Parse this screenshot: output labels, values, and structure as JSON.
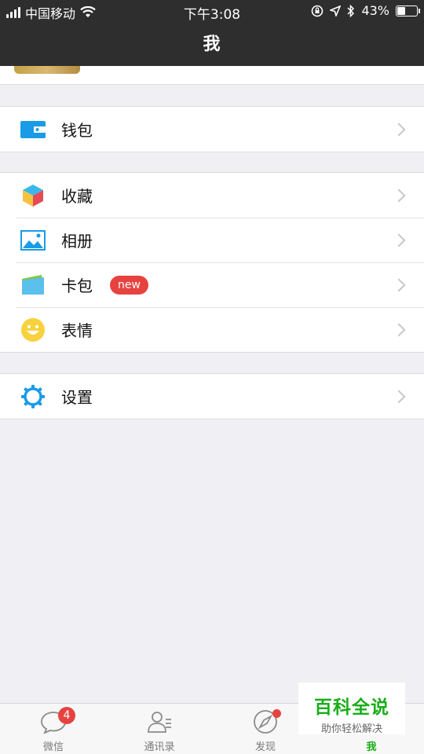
{
  "status_bar": {
    "carrier": "中国移动",
    "time": "下午3:08",
    "battery": "43%",
    "battery_level": 0.43,
    "icons": [
      "signal-icon",
      "wifi-icon",
      "lock-rotation-icon",
      "location-icon",
      "bluetooth-icon",
      "battery-icon"
    ]
  },
  "header": {
    "title": "我"
  },
  "groups": [
    {
      "items": [
        {
          "label": "钱包",
          "icon": "wallet-icon"
        }
      ]
    },
    {
      "items": [
        {
          "label": "收藏",
          "icon": "favorites-cube-icon"
        },
        {
          "label": "相册",
          "icon": "album-icon"
        },
        {
          "label": "卡包",
          "icon": "card-wallet-icon",
          "badge": "new"
        },
        {
          "label": "表情",
          "icon": "smiley-icon"
        }
      ]
    },
    {
      "items": [
        {
          "label": "设置",
          "icon": "gear-icon"
        }
      ]
    }
  ],
  "tabbar": {
    "tabs": [
      {
        "label": "微信",
        "icon": "chat-bubble-icon",
        "badge": "4"
      },
      {
        "label": "通讯录",
        "icon": "contacts-icon"
      },
      {
        "label": "发现",
        "icon": "compass-icon",
        "dot": true
      },
      {
        "label": "我",
        "icon": "person-icon",
        "active": true
      }
    ]
  },
  "watermark": {
    "title": "百科全说",
    "subtitle": "助你轻松解决"
  },
  "colors": {
    "accent": "#1aad19",
    "badge": "#e64340",
    "header_bg": "#2e2e2e",
    "page_bg": "#efeff4"
  }
}
